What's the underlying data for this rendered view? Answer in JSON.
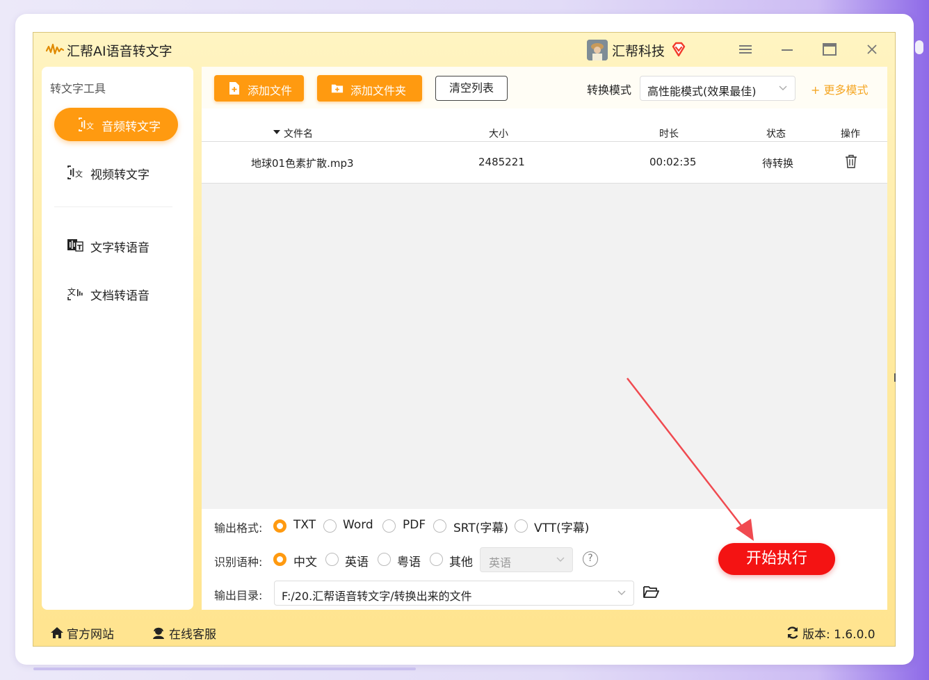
{
  "app": {
    "title": "汇帮AI语音转文字",
    "company": "汇帮科技",
    "window_controls": [
      "menu-icon",
      "minimize-icon",
      "maximize-icon",
      "close-icon"
    ],
    "accent_color": "#ff9a10",
    "start_color": "#f41313"
  },
  "sidebar": {
    "heading": "转文字工具",
    "items": [
      {
        "label": "音频转文字",
        "icon": "audio-to-text-icon",
        "active": true
      },
      {
        "label": "视频转文字",
        "icon": "video-to-text-icon",
        "active": false
      },
      {
        "label": "文字转语音",
        "icon": "text-to-speech-icon",
        "active": false
      },
      {
        "label": "文档转语音",
        "icon": "document-to-speech-icon",
        "active": false
      }
    ]
  },
  "toolbar": {
    "add_file": "添加文件",
    "add_folder": "添加文件夹",
    "clear_list": "清空列表",
    "mode_label": "转换模式",
    "mode_value": "高性能模式(效果最佳)",
    "more_modes": "+ 更多模式"
  },
  "table": {
    "columns": [
      "文件名",
      "大小",
      "时长",
      "状态",
      "操作"
    ],
    "rows": [
      {
        "name": "地球01色素扩散.mp3",
        "size": "2485221",
        "duration": "00:02:35",
        "status": "待转换"
      }
    ]
  },
  "options": {
    "format_label": "输出格式:",
    "formats": [
      "TXT",
      "Word",
      "PDF",
      "SRT(字幕)",
      "VTT(字幕)"
    ],
    "format_selected": "TXT",
    "lang_label": "识别语种:",
    "langs": [
      "中文",
      "英语",
      "粤语",
      "其他"
    ],
    "lang_selected": "中文",
    "other_lang_value": "英语",
    "help": "?",
    "dir_label": "输出目录:",
    "dir_value": "F:/20.汇帮语音转文字/转换出来的文件",
    "start": "开始执行"
  },
  "footer": {
    "website": "官方网站",
    "support": "在线客服",
    "version": "版本: 1.6.0.0"
  }
}
